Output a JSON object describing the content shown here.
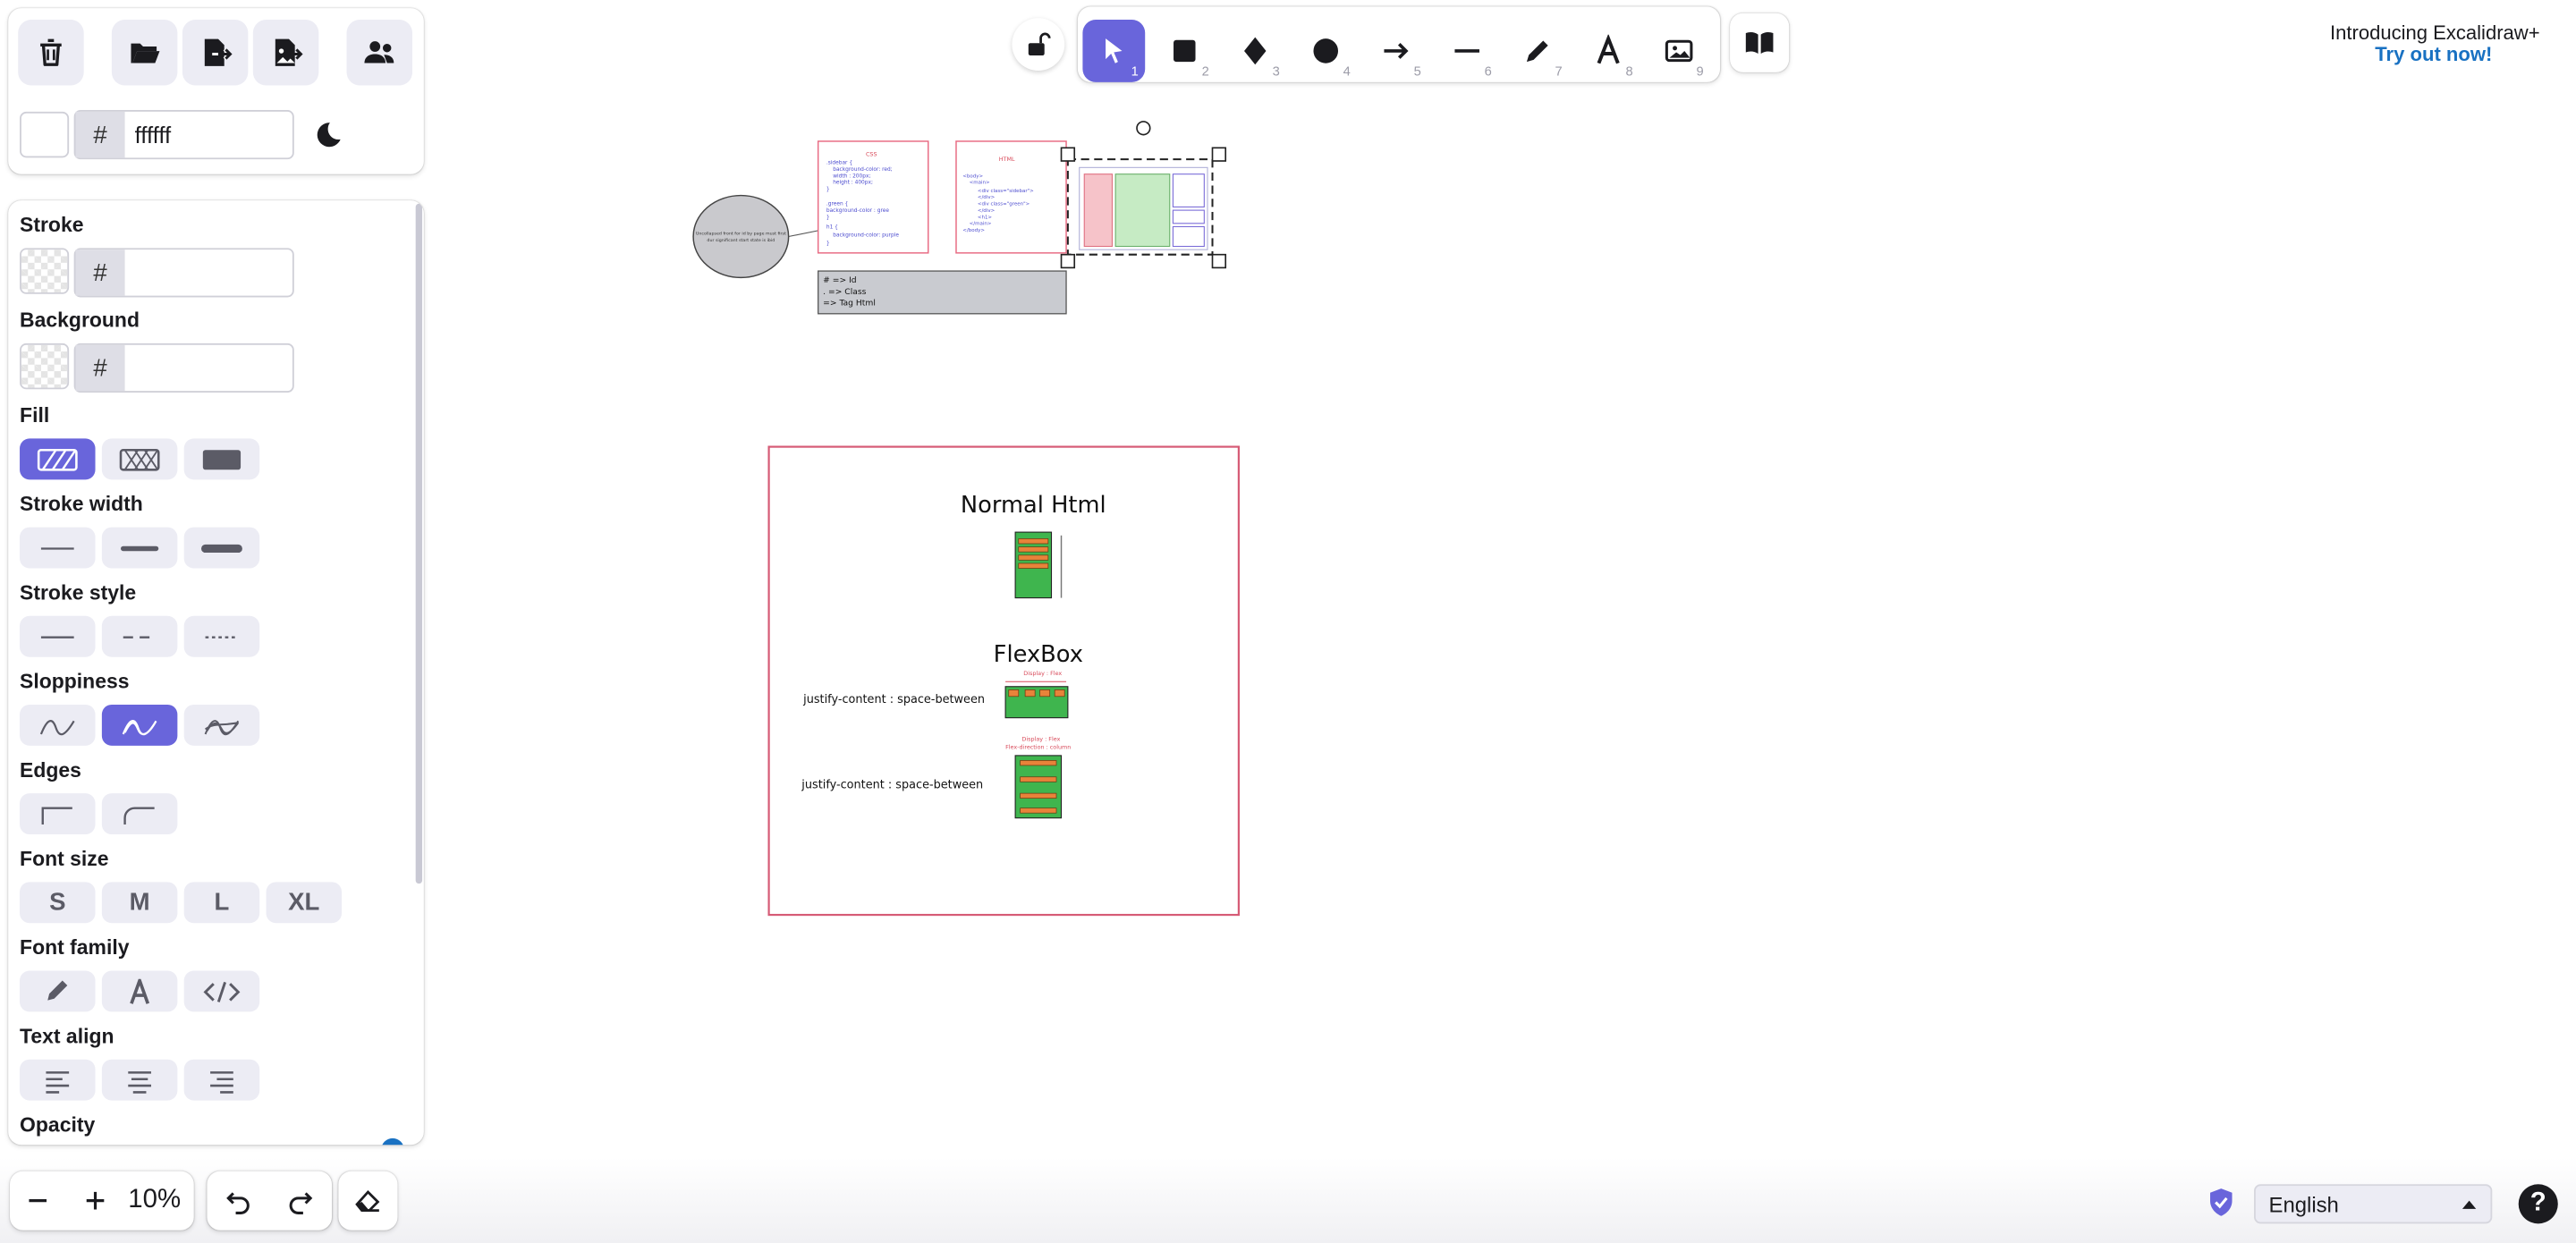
{
  "app": {
    "name": "Excalidraw",
    "accent": "#6965db"
  },
  "menu": {
    "buttons": [
      "clear-canvas",
      "open",
      "save-to",
      "export-image",
      "live-collaboration"
    ],
    "canvas_background": {
      "hash": "#",
      "value": "ffffff"
    }
  },
  "props": {
    "stroke": {
      "label": "Stroke",
      "hash": "#",
      "value": ""
    },
    "background": {
      "label": "Background",
      "hash": "#",
      "value": ""
    },
    "fill": {
      "label": "Fill",
      "options": [
        "hachure",
        "cross-hatch",
        "solid"
      ],
      "selected": "hachure"
    },
    "stroke_width": {
      "label": "Stroke width",
      "options": [
        "thin",
        "bold",
        "extra-bold"
      ]
    },
    "stroke_style": {
      "label": "Stroke style",
      "options": [
        "solid",
        "dashed",
        "dotted"
      ]
    },
    "sloppiness": {
      "label": "Sloppiness",
      "options": [
        "architect",
        "artist",
        "cartoonist"
      ],
      "selected": "artist"
    },
    "edges": {
      "label": "Edges",
      "options": [
        "sharp",
        "round"
      ]
    },
    "font_size": {
      "label": "Font size",
      "options": [
        "S",
        "M",
        "L",
        "XL"
      ]
    },
    "font_family": {
      "label": "Font family",
      "options": [
        "hand-drawn",
        "normal",
        "code"
      ]
    },
    "text_align": {
      "label": "Text align",
      "options": [
        "left",
        "center",
        "right"
      ]
    },
    "opacity": {
      "label": "Opacity"
    }
  },
  "toolbar": {
    "tools": [
      {
        "name": "selection",
        "key": "1"
      },
      {
        "name": "rectangle",
        "key": "2"
      },
      {
        "name": "diamond",
        "key": "3"
      },
      {
        "name": "ellipse",
        "key": "4"
      },
      {
        "name": "arrow",
        "key": "5"
      },
      {
        "name": "line",
        "key": "6"
      },
      {
        "name": "draw",
        "key": "7"
      },
      {
        "name": "text",
        "key": "8"
      },
      {
        "name": "image",
        "key": "9"
      }
    ],
    "active": "selection"
  },
  "promo": {
    "line1": "Introducing Excalidraw+",
    "link": "Try out now!"
  },
  "footer": {
    "zoom": "10%",
    "language": "English",
    "help": "?"
  },
  "canvas": {
    "ellipse_note": "Uncollapsed front for id by page must first  ",
    "legend_lines": [
      "# => Id",
      ". => Class",
      " => Tag Html"
    ],
    "css_title": "CSS",
    "html_title": "HTML",
    "normal_html": "Normal Html",
    "flexbox": "FlexBox",
    "jc_label_1": "justify-content : space-between",
    "jc_label_2": "justify-content : space-between",
    "display_flex_1": "Display : Flex",
    "display_flex_2": "Display : Flex",
    "flex_direction": "Flex-direction : column"
  }
}
